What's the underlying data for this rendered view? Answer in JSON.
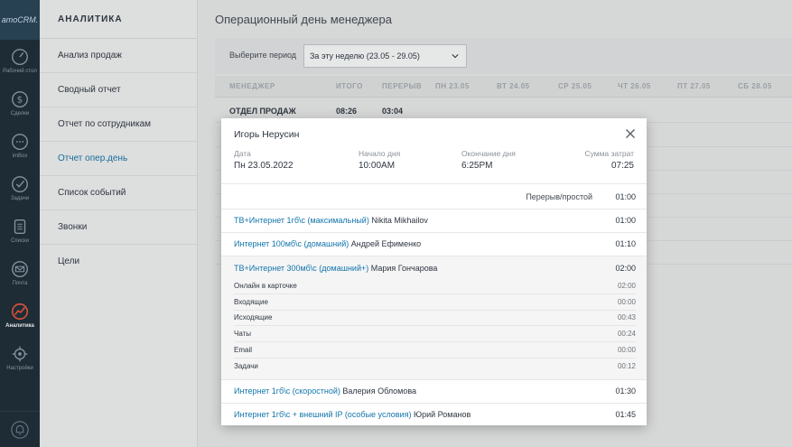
{
  "rail": {
    "logo": "amoCRM.",
    "items": [
      {
        "label": "Рабочий стол",
        "icon": "speedometer-icon"
      },
      {
        "label": "Сделки",
        "icon": "dollar-icon"
      },
      {
        "label": "imBox",
        "icon": "chat-icon"
      },
      {
        "label": "Задачи",
        "icon": "checkmark-icon"
      },
      {
        "label": "Списки",
        "icon": "list-icon"
      },
      {
        "label": "Почта",
        "icon": "mail-icon"
      },
      {
        "label": "Аналитика",
        "icon": "chart-icon"
      },
      {
        "label": "Настройки",
        "icon": "gear-icon"
      }
    ],
    "bottom_icon": "bell-icon"
  },
  "section": {
    "title": "АНАЛИТИКА",
    "items": [
      {
        "label": "Анализ продаж"
      },
      {
        "label": "Сводный отчет"
      },
      {
        "label": "Отчет по сотрудникам"
      },
      {
        "label": "Отчет опер.день"
      },
      {
        "label": "Список событий"
      },
      {
        "label": "Звонки"
      },
      {
        "label": "Цели"
      }
    ],
    "active_index": 3
  },
  "main": {
    "title": "Операционный день менеджера",
    "filter": {
      "label": "Выберите период",
      "value": "За эту неделю (23.05 - 29.05)"
    },
    "columns": [
      "МЕНЕДЖЕР",
      "ИТОГО",
      "ПЕРЕРЫВ",
      "ПН 23.05",
      "ВТ 24.05",
      "СР 25.05",
      "ЧТ 26.05",
      "ПТ 27.05",
      "СБ 28.05"
    ],
    "row": {
      "name": "ОТДЕЛ ПРОДАЖ",
      "total": "08:26",
      "break": "03:04"
    }
  },
  "modal": {
    "title": "Игорь Нерусин",
    "date_label": "Дата",
    "date_value": "Пн 23.05.2022",
    "start_label": "Начало дня",
    "start_value": "10:00AM",
    "end_label": "Окончание дня",
    "end_value": "6:25PM",
    "sum_label": "Сумма затрат",
    "sum_value": "07:25",
    "break_label": "Перерыв/простой",
    "break_value": "01:00",
    "deals": [
      {
        "link": "ТВ+Интернет 1гб\\с (максимальный)",
        "person": "Nikita Mikhailov",
        "time": "01:00"
      },
      {
        "link": "Интернет 100мб\\с (домашний)",
        "person": "Андрей Ефименко",
        "time": "01:10"
      },
      {
        "link": "ТВ+Интернет 300мб\\с (домашний+)",
        "person": "Мария Гончарова",
        "time": "02:00"
      },
      {
        "link": "Интернет 1гб\\с (скоростной)",
        "person": "Валерия Обломова",
        "time": "01:30"
      },
      {
        "link": "Интернет 1гб\\с + внешний IP (особые условия)",
        "person": "Юрий Романов",
        "time": "01:45"
      }
    ],
    "details": [
      {
        "label": "Онлайн в карточке",
        "time": "02:00"
      },
      {
        "label": "Входящие",
        "time": "00:00"
      },
      {
        "label": "Исходящие",
        "time": "00:43"
      },
      {
        "label": "Чаты",
        "time": "00:24"
      },
      {
        "label": "Email",
        "time": "00:00"
      },
      {
        "label": "Задачи",
        "time": "00:12"
      }
    ]
  }
}
